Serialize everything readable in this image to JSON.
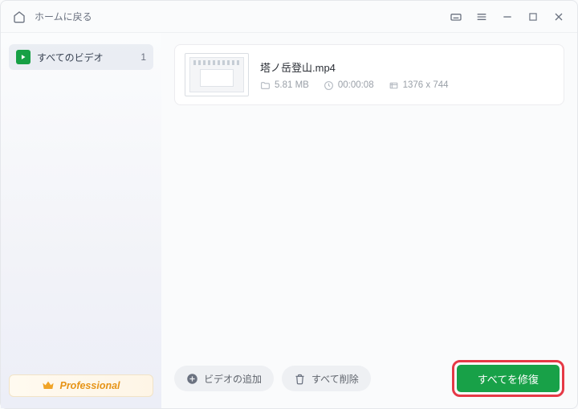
{
  "titlebar": {
    "home_label": "ホームに戻る"
  },
  "sidebar": {
    "items": [
      {
        "label": "すべてのビデオ",
        "count": "1"
      }
    ],
    "pro_label": "Professional"
  },
  "file": {
    "name": "塔ノ岳登山.mp4",
    "size": "5.81 MB",
    "duration": "00:00:08",
    "dimensions": "1376 x 744"
  },
  "footer": {
    "add_label": "ビデオの追加",
    "remove_all_label": "すべて削除",
    "repair_all_label": "すべてを修復"
  }
}
